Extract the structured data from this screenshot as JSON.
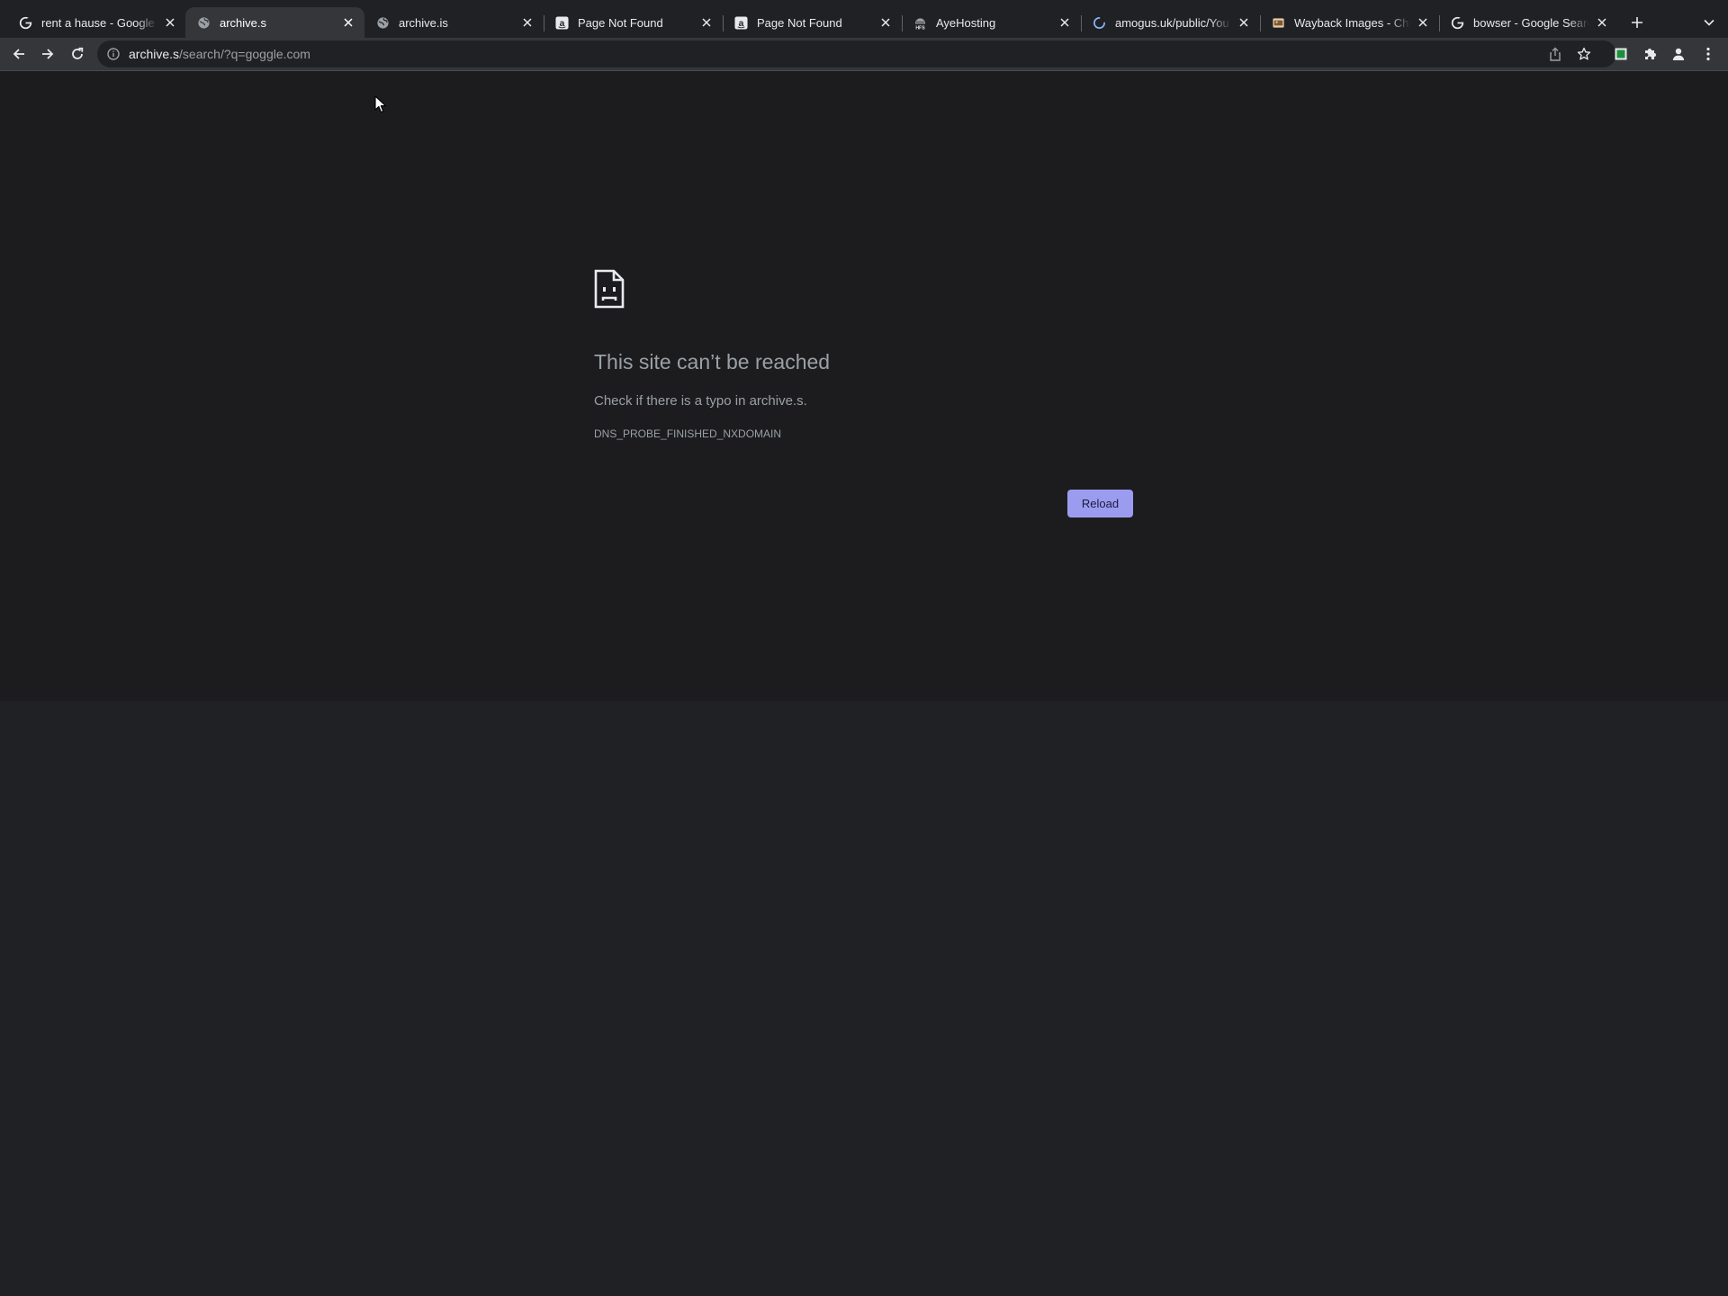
{
  "tabs": [
    {
      "title": "rent a hause - Google Search",
      "favicon": "google-g-icon",
      "active": false
    },
    {
      "title": "archive.s",
      "favicon": "globe-icon",
      "active": true
    },
    {
      "title": "archive.is",
      "favicon": "globe-icon",
      "active": false
    },
    {
      "title": "Page Not Found",
      "favicon": "amazon-a-icon",
      "active": false
    },
    {
      "title": "Page Not Found",
      "favicon": "amazon-a-icon",
      "active": false
    },
    {
      "title": "AyeHosting",
      "favicon": "hfs-icon",
      "active": false
    },
    {
      "title": "amogus.uk/public/You Tube",
      "favicon": "loading-spinner-icon",
      "active": false
    },
    {
      "title": "Wayback Images - Chrome",
      "favicon": "wayback-icon",
      "active": false
    },
    {
      "title": "bowser - Google Search",
      "favicon": "google-g-icon",
      "active": false
    }
  ],
  "omnibox": {
    "host": "archive.s",
    "path": "/search/?q=goggle.com"
  },
  "error": {
    "title": "This site can’t be reached",
    "description": "Check if there is a typo in archive.s.",
    "code": "DNS_PROBE_FINISHED_NXDOMAIN",
    "reload_label": "Reload"
  },
  "colors": {
    "tabstrip": "#202124",
    "toolbar": "#35363a",
    "page_bg": "#1c1c1e",
    "reload_button": "#9b9cf0"
  }
}
